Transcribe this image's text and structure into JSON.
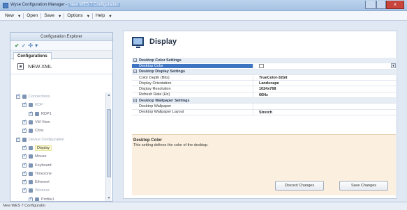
{
  "window": {
    "app_title": "Wyse Configuration Manager - ",
    "doc_title": "New WES 7 Configuration"
  },
  "menu": [
    "New",
    "Open",
    "Save",
    "Options",
    "Help"
  ],
  "explorer": {
    "title": "Configuration Explorer",
    "tab": "Configurations",
    "file": "NEW.XML",
    "tree": [
      {
        "label": "Connections",
        "indent": 0,
        "state": "dim"
      },
      {
        "label": "RDP",
        "indent": 1,
        "state": "dim"
      },
      {
        "label": "RDP1",
        "indent": 2,
        "state": ""
      },
      {
        "label": "VM View",
        "indent": 1,
        "state": ""
      },
      {
        "label": "Citrix",
        "indent": 1,
        "state": ""
      },
      {
        "label": "Device Configuration",
        "indent": 0,
        "state": "dim"
      },
      {
        "label": "Display",
        "indent": 1,
        "state": "sel"
      },
      {
        "label": "Mouse",
        "indent": 1,
        "state": ""
      },
      {
        "label": "Keyboard",
        "indent": 1,
        "state": ""
      },
      {
        "label": "Timezone",
        "indent": 1,
        "state": ""
      },
      {
        "label": "Ethernet",
        "indent": 1,
        "state": ""
      },
      {
        "label": "Wireless",
        "indent": 1,
        "state": "dim"
      },
      {
        "label": "Profile1",
        "indent": 2,
        "state": ""
      }
    ]
  },
  "page": {
    "title": "Display"
  },
  "settings": {
    "group1": "Desktop Color Settings",
    "desktop_color": "Desktop Color",
    "group2": "Desktop Display Settings",
    "rows2": [
      {
        "k": "Color Depth (Bits)",
        "v": "TrueColor-32bit"
      },
      {
        "k": "Display Orientation",
        "v": "Landscape"
      },
      {
        "k": "Display Resolution",
        "v": "1024x768"
      },
      {
        "k": "Refresh Rate (Hz)",
        "v": "60Hz"
      }
    ],
    "group3": "Desktop Wallpaper Settings",
    "rows3": [
      {
        "k": "Desktop Wallpaper",
        "v": ""
      },
      {
        "k": "Desktop Wallpaper Layout",
        "v": "Stretch"
      }
    ]
  },
  "description": {
    "title": "Desktop Color",
    "text": "This setting defines the color of the desktop."
  },
  "buttons": {
    "discard": "Discard Changes",
    "save": "Save Changes"
  },
  "status": "New WES 7 Configuratio"
}
